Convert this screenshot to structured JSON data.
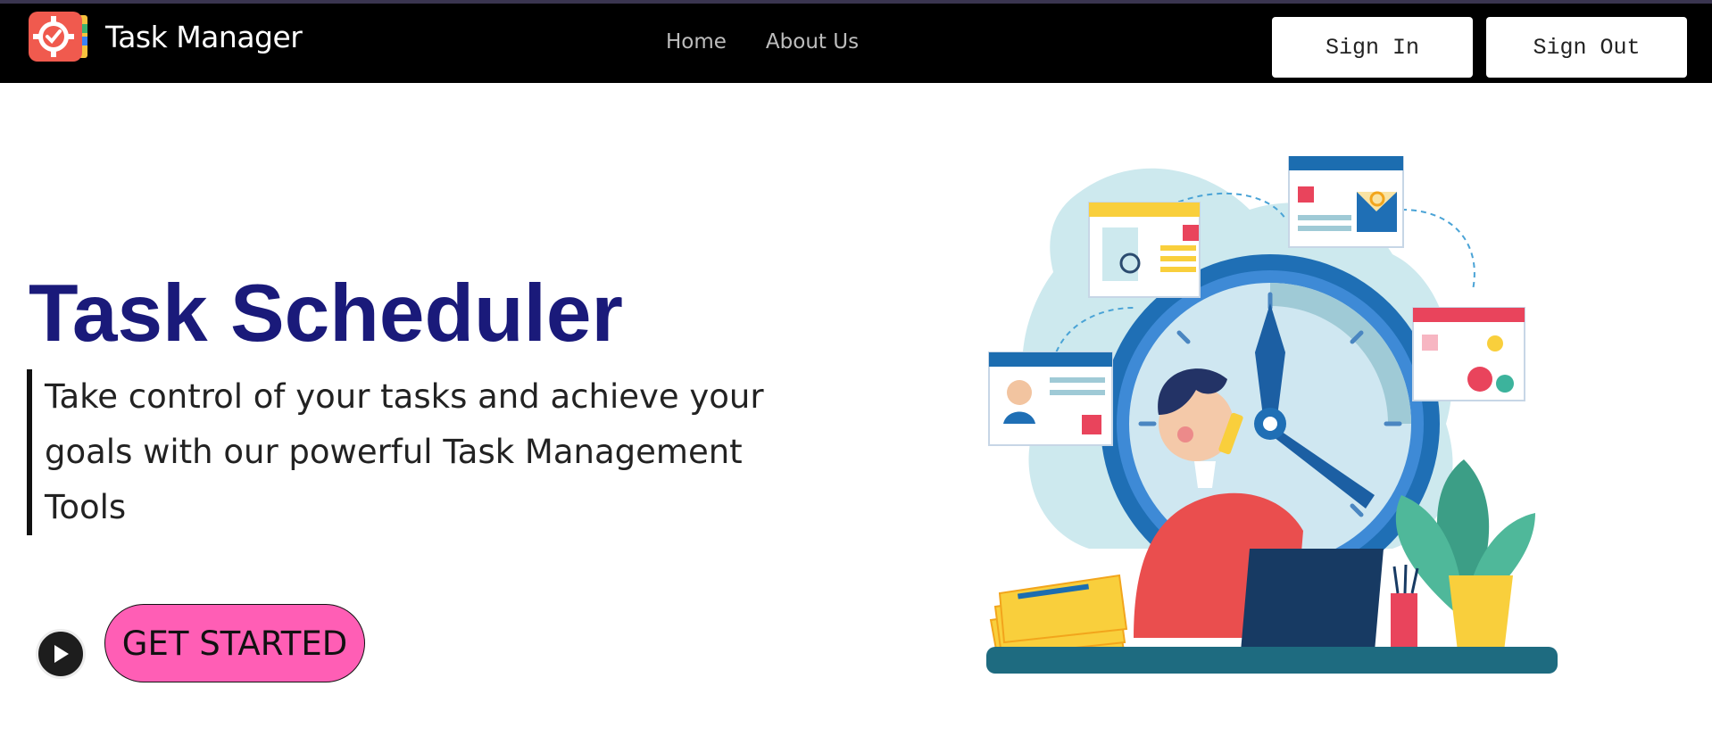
{
  "app": {
    "title": "Task Manager"
  },
  "nav": {
    "links": [
      "Home",
      "About Us"
    ],
    "sign_in_label": "Sign In",
    "sign_out_label": "Sign Out"
  },
  "hero": {
    "title": "Task Scheduler",
    "subtitle": "Take control of your tasks and achieve your goals with our powerful Task Management Tools",
    "cta_label": "GET STARTED"
  },
  "icons": {
    "logo": "task-manager-logo-icon",
    "play": "play-icon",
    "illustration": "person-with-clock-illustration"
  },
  "colors": {
    "navbar_bg": "#000000",
    "title_color": "#1a1a7a",
    "cta_bg": "#ff5eb5",
    "accent_blue": "#1f6fb5"
  }
}
